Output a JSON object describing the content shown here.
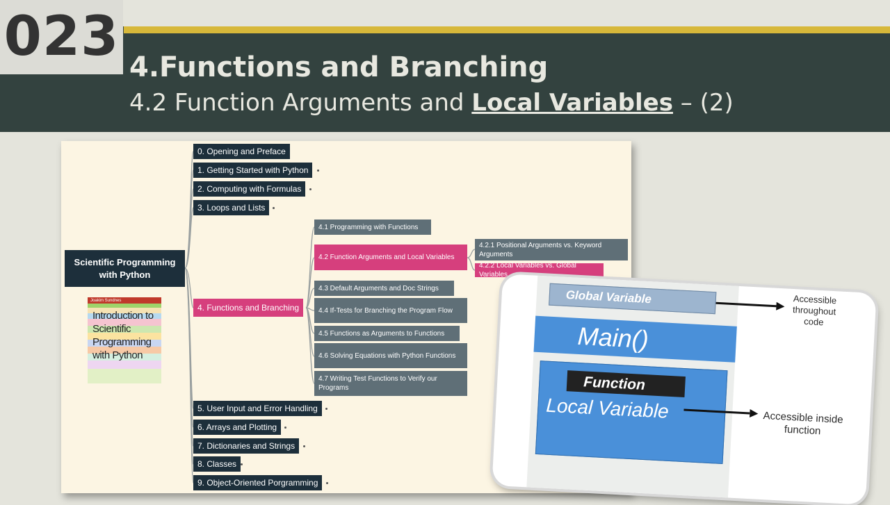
{
  "slide": {
    "number": "023",
    "title": "4.Functions and Branching",
    "subtitle_prefix": "4.2 Function Arguments and ",
    "subtitle_emphasis": "Local Variables",
    "subtitle_suffix": " – (2)"
  },
  "mindmap": {
    "root": "Scientific Programming with Python",
    "book": {
      "author": "Joakim Sundnes",
      "title": "Introduction to Scientific Programming with Python"
    },
    "chapters": [
      "0. Opening and Preface",
      "1. Getting Started with Python",
      "2. Computing with Formulas",
      "3. Loops and Lists",
      "4. Functions and Branching",
      "5. User Input and Error Handling",
      "6. Arrays and Plotting",
      "7. Dictionaries and Strings",
      "8. Classes",
      "9. Object-Oriented Porgramming"
    ],
    "sections": [
      "4.1 Programming with Functions",
      "4.2 Function Arguments and Local Variables",
      "4.3 Default Arguments and Doc Strings",
      "4.4 If-Tests for Branching the Program Flow",
      "4.5 Functions as Arguments to Functions",
      "4.6 Solving Equations with Python Functions",
      "4.7 Writing Test Functions to Verify our Programs"
    ],
    "subsections": [
      "4.2.1 Positional Arguments vs. Keyword Arguments",
      "4.2.2 Local Variables vs. Global Variables"
    ]
  },
  "diagram": {
    "global_label": "Global Variable",
    "main_label": "Main()",
    "function_label": "Function",
    "local_label": "Local Variable",
    "global_note": "Accessible throughout code",
    "local_note": "Accessible inside function"
  },
  "colors": {
    "header": "#33423f",
    "gold": "#d7b83a",
    "node_dark": "#1d2f3b",
    "node_pink": "#d63f7d",
    "node_gray": "#5f6f77",
    "diagram_blue": "#4a90d9"
  }
}
